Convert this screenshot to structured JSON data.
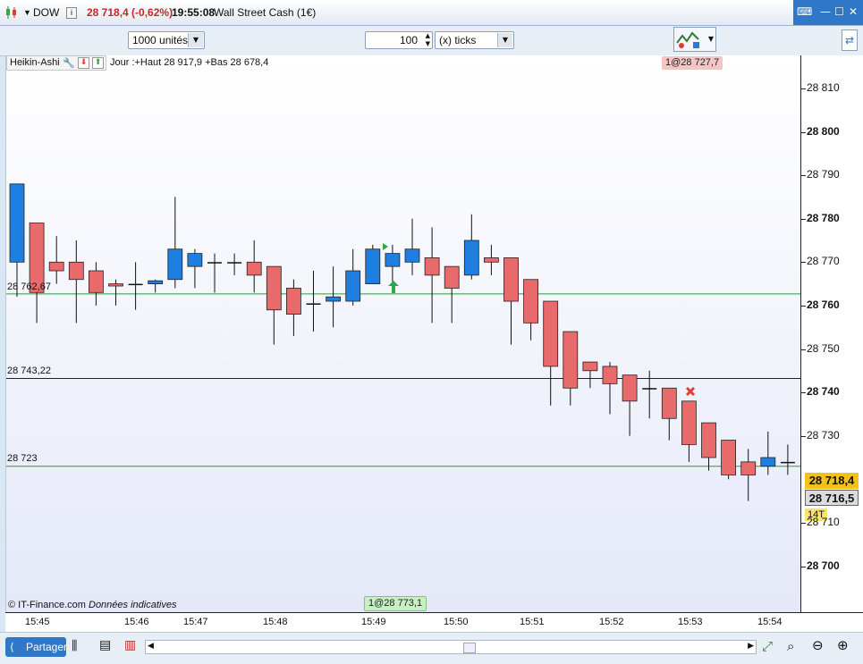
{
  "window": {
    "symbol": "DOW",
    "price_change": "28 718,4 (-0,62%)",
    "time": "19:55:08",
    "instrument": "Wall Street Cash (1€)"
  },
  "toolbar": {
    "quantity": "1000 unités",
    "ticks_value": "100",
    "ticks_unit": "(x) ticks"
  },
  "chart": {
    "indicator_name": "Heikin-Ashi",
    "daily_range": "Jour :+Haut 28 917,9 +Bas 28 678,4",
    "top_order_badge": "1@28 727,7",
    "bottom_order_badge": "1@28 773,1",
    "line_labels": [
      "28 762,67",
      "28 743,22",
      "28 723"
    ],
    "copyright": "© IT-Finance.com",
    "disclaimer": "Données indicatives",
    "colors": {
      "bull": "#1e7fe0",
      "bear": "#e86a6a",
      "support": "#2f9a3c",
      "resistance": "#222222"
    }
  },
  "chart_data": {
    "type": "candlestick",
    "ylim": [
      28690,
      28815
    ],
    "yticks": [
      "28 810",
      "28 800",
      "28 790",
      "28 780",
      "28 770",
      "28 760",
      "28 750",
      "28 740",
      "28 730",
      "28 710",
      "28 700"
    ],
    "xticks": [
      "15:45",
      "15:46",
      "15:47",
      "15:48",
      "15:49",
      "15:50",
      "15:51",
      "15:52",
      "15:53",
      "15:54"
    ],
    "horizontal_lines": [
      28762.67,
      28743.22,
      28723
    ],
    "last_price": "28 718,4",
    "bid_price": "28 716,5",
    "ticks_badge": "14T",
    "candles": [
      {
        "o": 28770,
        "c": 28788,
        "h": 28788,
        "l": 28762
      },
      {
        "o": 28779,
        "c": 28763,
        "h": 28779,
        "l": 28756
      },
      {
        "o": 28770,
        "c": 28768,
        "h": 28776,
        "l": 28765
      },
      {
        "o": 28770,
        "c": 28766,
        "h": 28775,
        "l": 28756
      },
      {
        "o": 28768,
        "c": 28763,
        "h": 28770,
        "l": 28760
      },
      {
        "o": 28765,
        "c": 28764.5,
        "h": 28766,
        "l": 28760
      },
      {
        "o": 28765,
        "c": 28765,
        "h": 28770,
        "l": 28759
      },
      {
        "o": 28765,
        "c": 28765.7,
        "h": 28766,
        "l": 28763
      },
      {
        "o": 28766,
        "c": 28773,
        "h": 28785,
        "l": 28764
      },
      {
        "o": 28769,
        "c": 28772,
        "h": 28773,
        "l": 28764
      },
      {
        "o": 28770,
        "c": 28770,
        "h": 28772,
        "l": 28763
      },
      {
        "o": 28770,
        "c": 28770,
        "h": 28772,
        "l": 28767
      },
      {
        "o": 28770,
        "c": 28767,
        "h": 28775,
        "l": 28763
      },
      {
        "o": 28769,
        "c": 28759,
        "h": 28769,
        "l": 28751
      },
      {
        "o": 28764,
        "c": 28758,
        "h": 28766,
        "l": 28753
      },
      {
        "o": 28760.5,
        "c": 28760.5,
        "h": 28768,
        "l": 28754
      },
      {
        "o": 28761,
        "c": 28762,
        "h": 28769,
        "l": 28755
      },
      {
        "o": 28761,
        "c": 28768,
        "h": 28773,
        "l": 28760
      },
      {
        "o": 28765,
        "c": 28773,
        "h": 28774,
        "l": 28765
      },
      {
        "o": 28769,
        "c": 28772,
        "h": 28774,
        "l": 28764
      },
      {
        "o": 28770,
        "c": 28773,
        "h": 28780,
        "l": 28767
      },
      {
        "o": 28771,
        "c": 28767,
        "h": 28778,
        "l": 28756
      },
      {
        "o": 28769,
        "c": 28764,
        "h": 28769,
        "l": 28756
      },
      {
        "o": 28767,
        "c": 28775,
        "h": 28781,
        "l": 28766
      },
      {
        "o": 28771,
        "c": 28770,
        "h": 28774,
        "l": 28767
      },
      {
        "o": 28771,
        "c": 28761,
        "h": 28771,
        "l": 28751
      },
      {
        "o": 28766,
        "c": 28756,
        "h": 28766,
        "l": 28752
      },
      {
        "o": 28761,
        "c": 28746,
        "h": 28761,
        "l": 28737
      },
      {
        "o": 28754,
        "c": 28741,
        "h": 28754,
        "l": 28737
      },
      {
        "o": 28747,
        "c": 28745,
        "h": 28747,
        "l": 28741
      },
      {
        "o": 28746,
        "c": 28742,
        "h": 28747,
        "l": 28735
      },
      {
        "o": 28744,
        "c": 28738,
        "h": 28744,
        "l": 28730
      },
      {
        "o": 28741,
        "c": 28741,
        "h": 28745,
        "l": 28734
      },
      {
        "o": 28741,
        "c": 28734,
        "h": 28741,
        "l": 28729
      },
      {
        "o": 28738,
        "c": 28728,
        "h": 28738,
        "l": 28724
      },
      {
        "o": 28733,
        "c": 28725,
        "h": 28733,
        "l": 28722
      },
      {
        "o": 28729,
        "c": 28721,
        "h": 28729,
        "l": 28720
      },
      {
        "o": 28724,
        "c": 28721,
        "h": 28727,
        "l": 28715
      },
      {
        "o": 28723,
        "c": 28725,
        "h": 28731,
        "l": 28721
      },
      {
        "o": 28724,
        "c": 28724,
        "h": 28728,
        "l": 28721
      }
    ]
  },
  "bottombar": {
    "share_label": "Partager"
  }
}
